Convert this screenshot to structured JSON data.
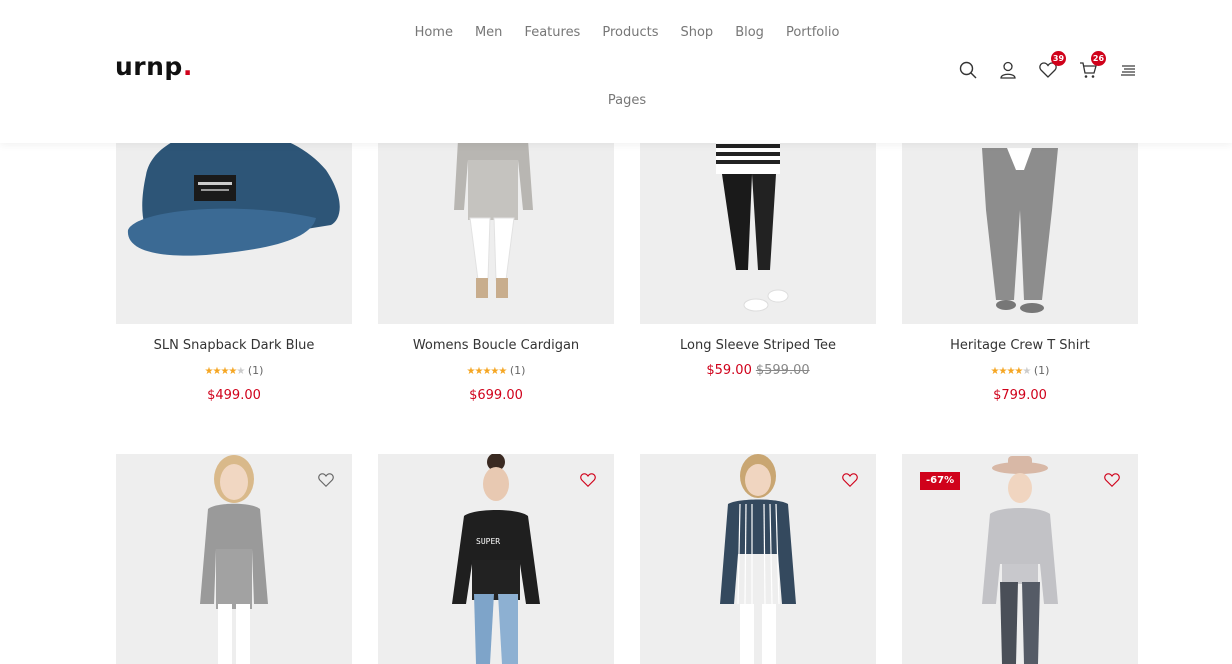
{
  "brand": {
    "logo": "urnp",
    "logo_dot": "."
  },
  "nav": [
    "Home",
    "Men",
    "Features",
    "Products",
    "Shop",
    "Blog",
    "Portfolio",
    "Pages"
  ],
  "header_icons": {
    "wishlist_count": "39",
    "cart_count": "26"
  },
  "colors": {
    "accent": "#d0021b",
    "star": "#f5a623",
    "image_bg": "#eeeeee"
  },
  "products_row1": [
    {
      "title": "SLN Snapback Dark Blue",
      "stars": 4,
      "reviews": "(1)",
      "price": "$499.00",
      "old_price": ""
    },
    {
      "title": "Womens Boucle Cardigan",
      "stars": 5,
      "reviews": "(1)",
      "price": "$699.00",
      "old_price": ""
    },
    {
      "title": "Long Sleeve Striped Tee",
      "stars": 0,
      "reviews": "",
      "price": "$59.00",
      "old_price": "$599.00"
    },
    {
      "title": "Heritage Crew T Shirt",
      "stars": 4,
      "reviews": "(1)",
      "price": "$799.00",
      "old_price": ""
    }
  ],
  "products_row2": [
    {
      "badge": "",
      "wishlisted": false
    },
    {
      "badge": "",
      "wishlisted": true
    },
    {
      "badge": "",
      "wishlisted": true
    },
    {
      "badge": "-67%",
      "wishlisted": true
    }
  ]
}
